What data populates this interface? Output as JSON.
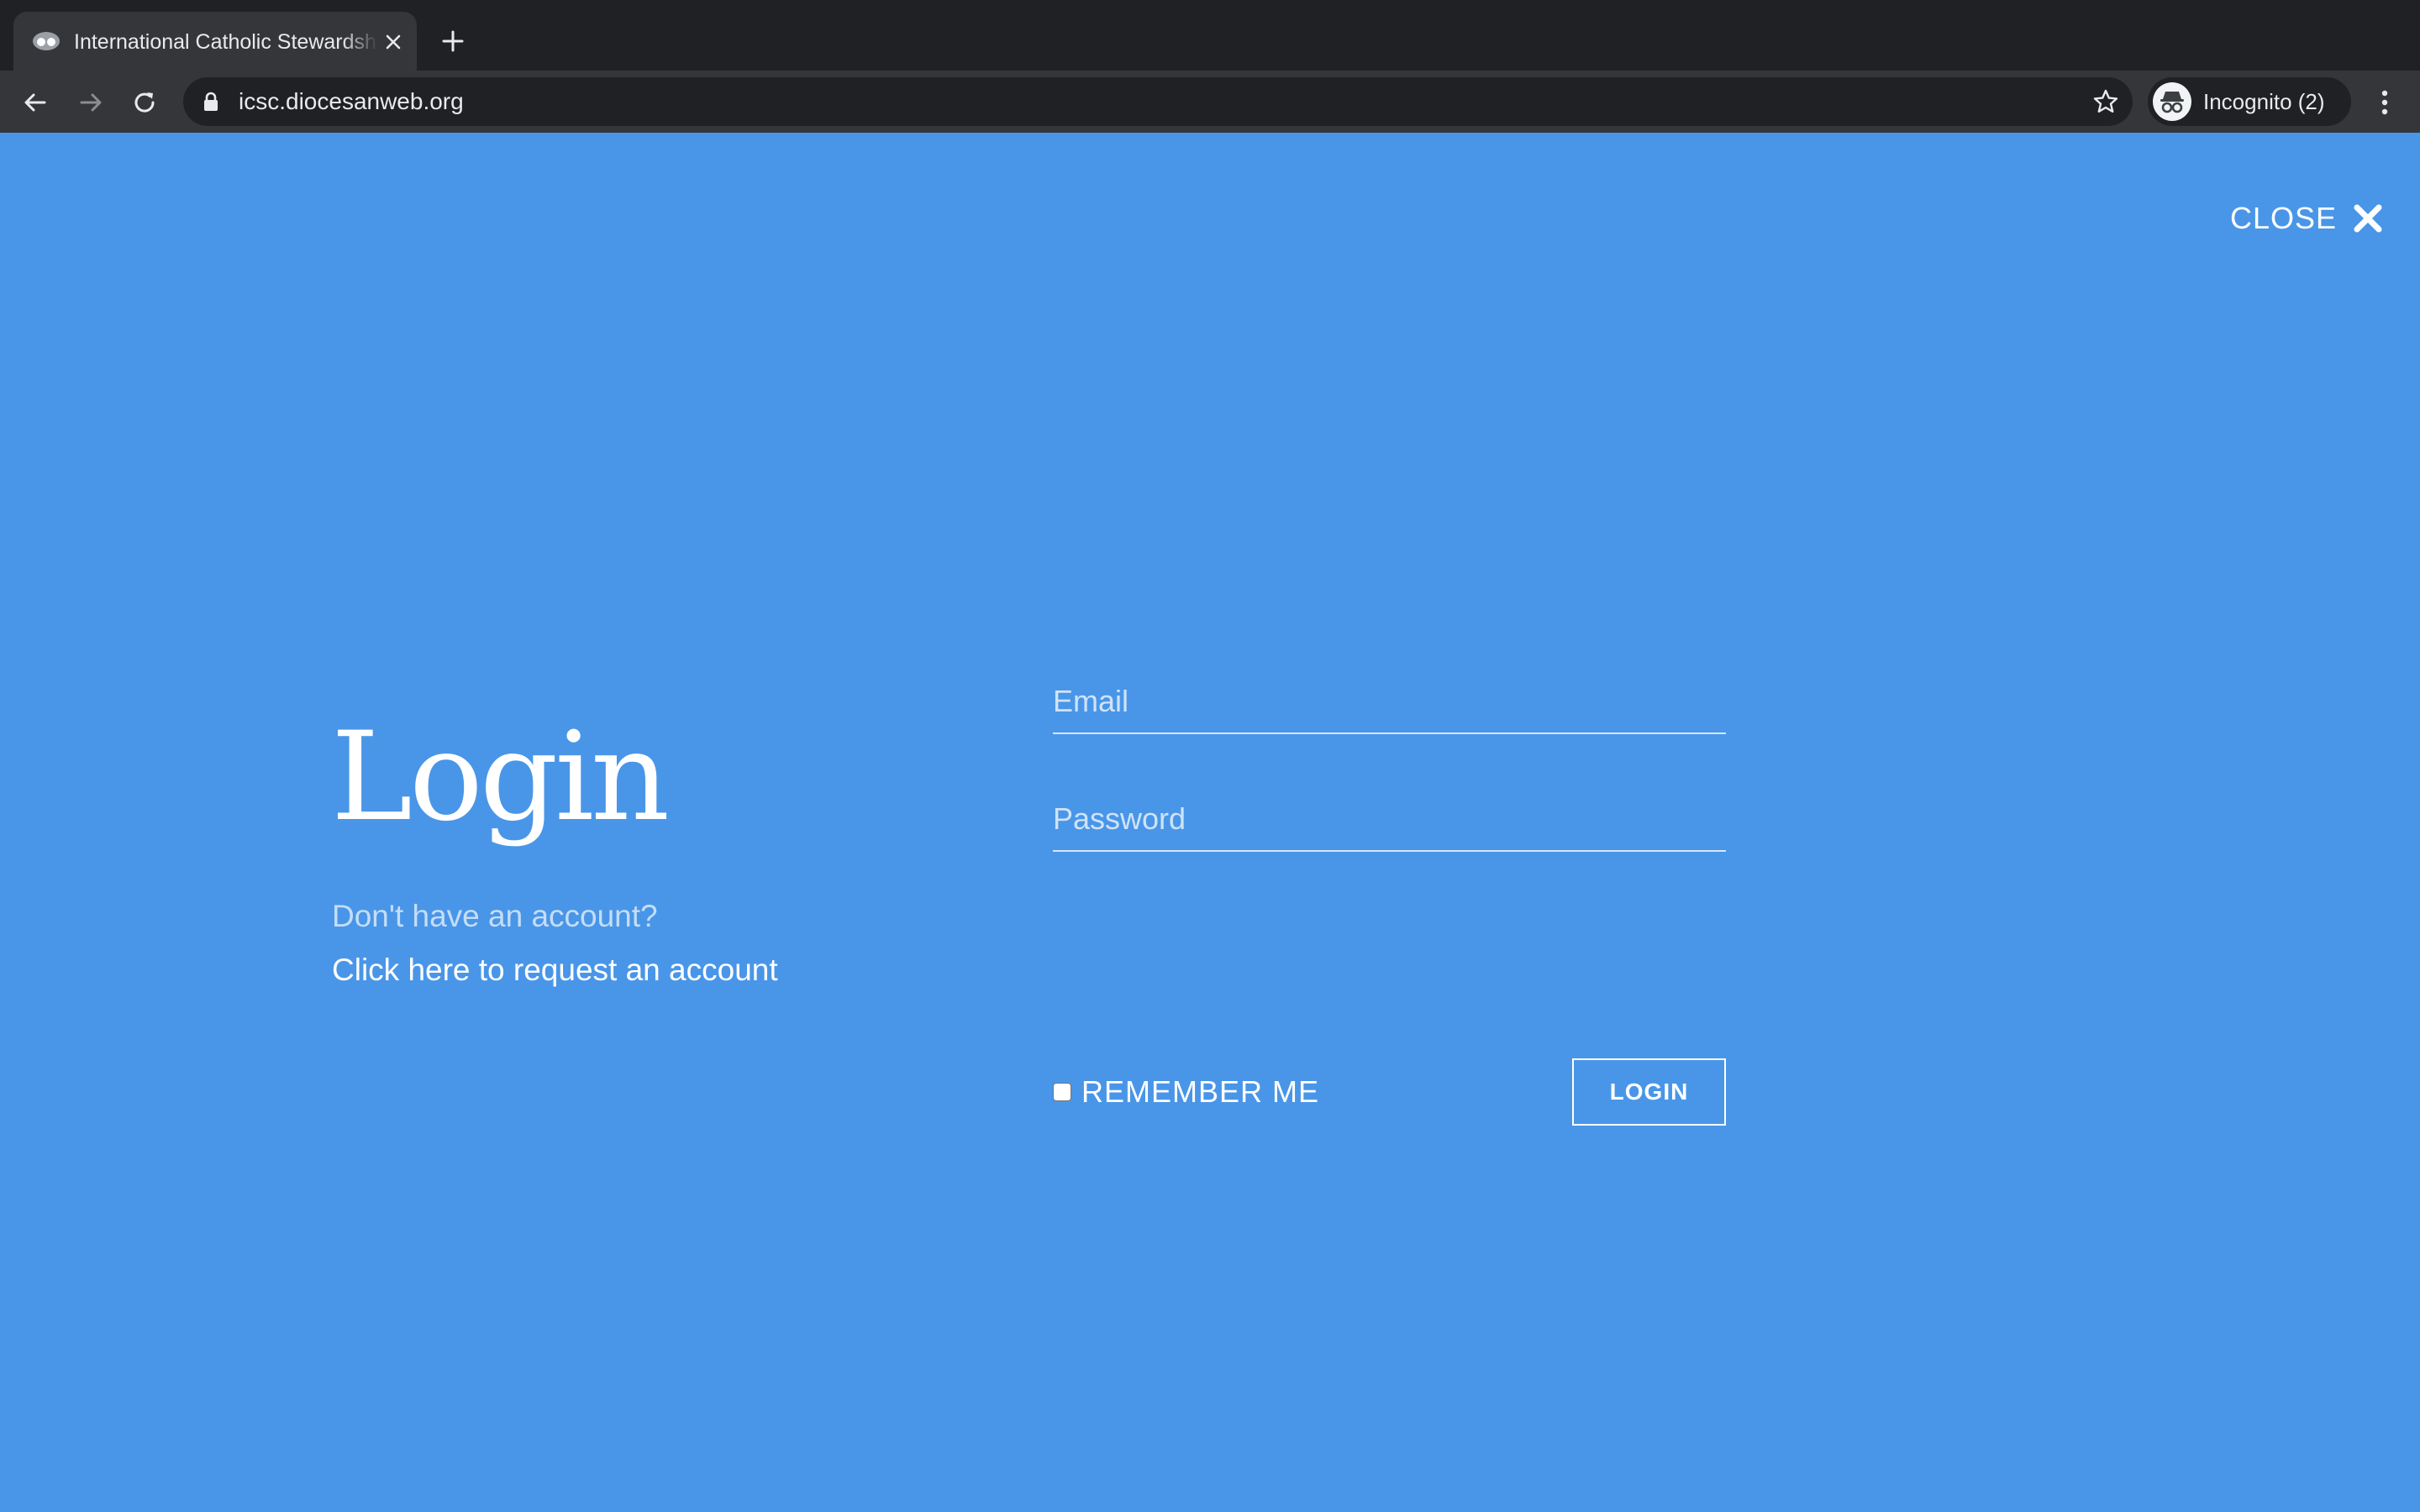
{
  "browser": {
    "tab": {
      "title": "International Catholic Stewardship Council",
      "favicon": "incognito-tab-icon"
    },
    "new_tab_icon": "plus-icon",
    "toolbar": {
      "back_icon": "arrow-left-icon",
      "forward_icon": "arrow-right-icon",
      "reload_icon": "reload-icon",
      "url": "icsc.diocesanweb.org",
      "lock_icon": "lock-icon",
      "star_icon": "star-icon",
      "profile_label": "Incognito (2)",
      "menu_icon": "kebab-menu-icon"
    }
  },
  "page": {
    "background_color": "#4996e8",
    "close_label": "CLOSE",
    "close_icon": "close-icon",
    "login_title": "Login",
    "no_account_text": "Don't have an account?",
    "request_link_text": "Click here to request an account",
    "form": {
      "email_placeholder": "Email",
      "email_value": "",
      "password_placeholder": "Password",
      "password_value": "",
      "remember_label": "REMEMBER ME",
      "remember_checked": false,
      "submit_label": "LOGIN"
    }
  }
}
